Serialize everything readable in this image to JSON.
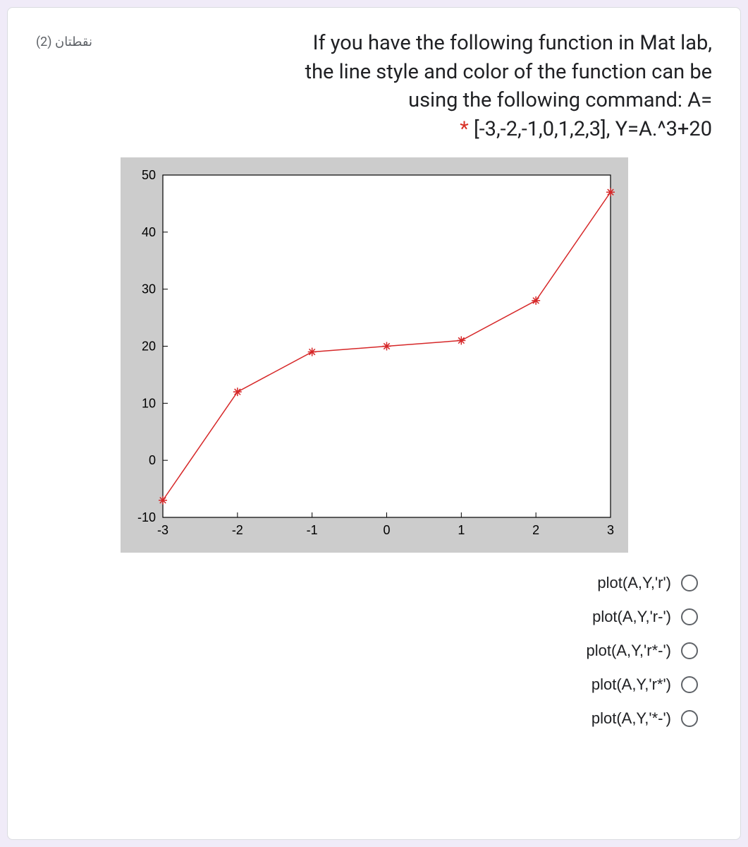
{
  "points_label": "نقطتان (2)",
  "question": {
    "line1": "If you have the following function in Mat lab,",
    "line2": "the line style and color of the function can be",
    "line3": "using the following command: A=",
    "line4": "[-3,-2,-1,0,1,2,3], Y=A.^3+20",
    "required": "*"
  },
  "chart_data": {
    "type": "line",
    "x": [
      -3,
      -2,
      -1,
      0,
      1,
      2,
      3
    ],
    "y": [
      -7,
      12,
      19,
      20,
      21,
      28,
      47
    ],
    "line_color": "#d62728",
    "marker": "*",
    "xlim": [
      -3,
      3
    ],
    "ylim": [
      -10,
      50
    ],
    "xticks": [
      -3,
      -2,
      -1,
      0,
      1,
      2,
      3
    ],
    "yticks": [
      -10,
      0,
      10,
      20,
      30,
      40,
      50
    ],
    "title": "",
    "xlabel": "",
    "ylabel": ""
  },
  "options": [
    {
      "label": "plot(A,Y,'r')"
    },
    {
      "label": "plot(A,Y,'r-')"
    },
    {
      "label": "plot(A,Y,'r*-')"
    },
    {
      "label": "plot(A,Y,'r*')"
    },
    {
      "label": "plot(A,Y,'*-')"
    }
  ]
}
